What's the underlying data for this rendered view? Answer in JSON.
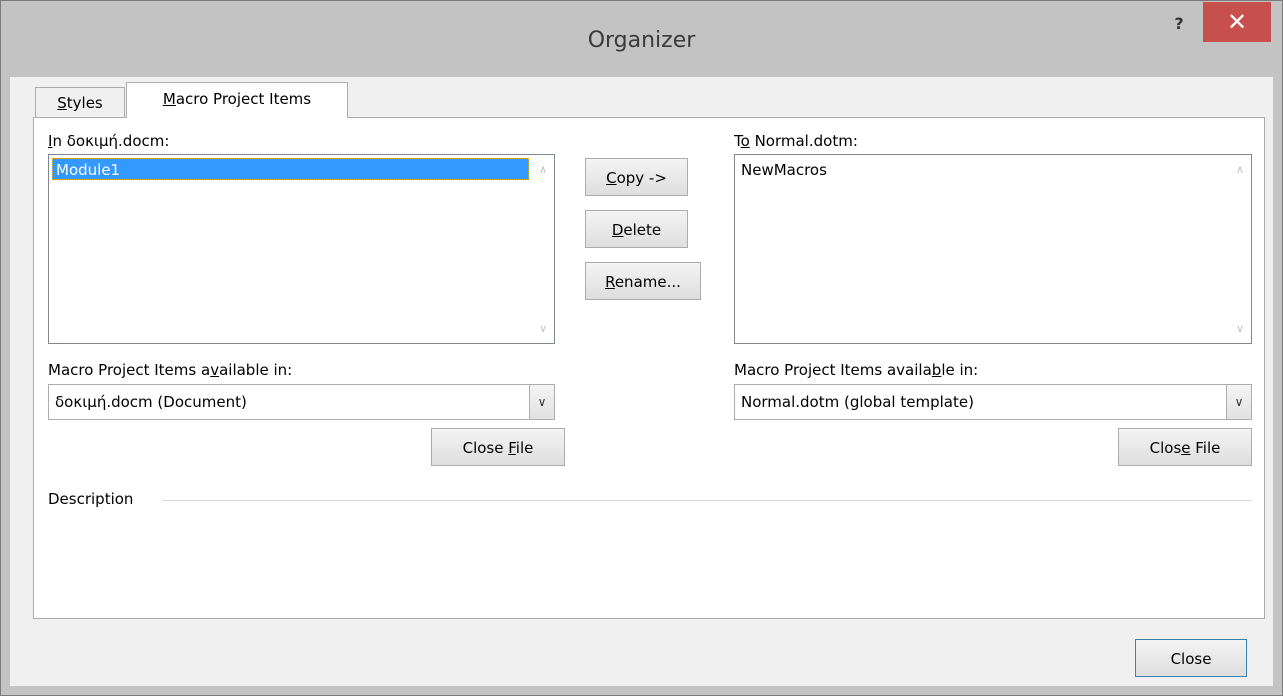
{
  "window": {
    "title": "Organizer",
    "help_glyph": "?",
    "close_glyph": "✕"
  },
  "tabs": [
    {
      "label": "Styles",
      "mnemonic_index": 0,
      "active": false
    },
    {
      "label": "Macro Project Items",
      "mnemonic_index": 0,
      "active": true
    }
  ],
  "left": {
    "list_label_pre": "",
    "list_label_u": "I",
    "list_label_post": "n δοκιμή.docm:",
    "items": [
      "Module1"
    ],
    "selected": "Module1",
    "available_label_pre": "Macro Project Items a",
    "available_label_u": "v",
    "available_label_post": "ailable in:",
    "available_value": "δοκιμή.docm (Document)",
    "close_file_pre": "Close ",
    "close_file_u": "F",
    "close_file_post": "ile"
  },
  "middle": {
    "copy_u": "C",
    "copy_post": "opy ->",
    "delete_u": "D",
    "delete_post": "elete",
    "rename_u": "R",
    "rename_post": "ename..."
  },
  "right": {
    "list_label_pre": "T",
    "list_label_u": "o",
    "list_label_post": " Normal.dotm:",
    "items": [
      "NewMacros"
    ],
    "available_label_pre": "Macro Project Items availa",
    "available_label_u": "b",
    "available_label_post": "le in:",
    "available_value": "Normal.dotm (global template)",
    "close_file_pre": "Clos",
    "close_file_u": "e",
    "close_file_post": " File"
  },
  "description_label": "Description",
  "close_button": "Close"
}
